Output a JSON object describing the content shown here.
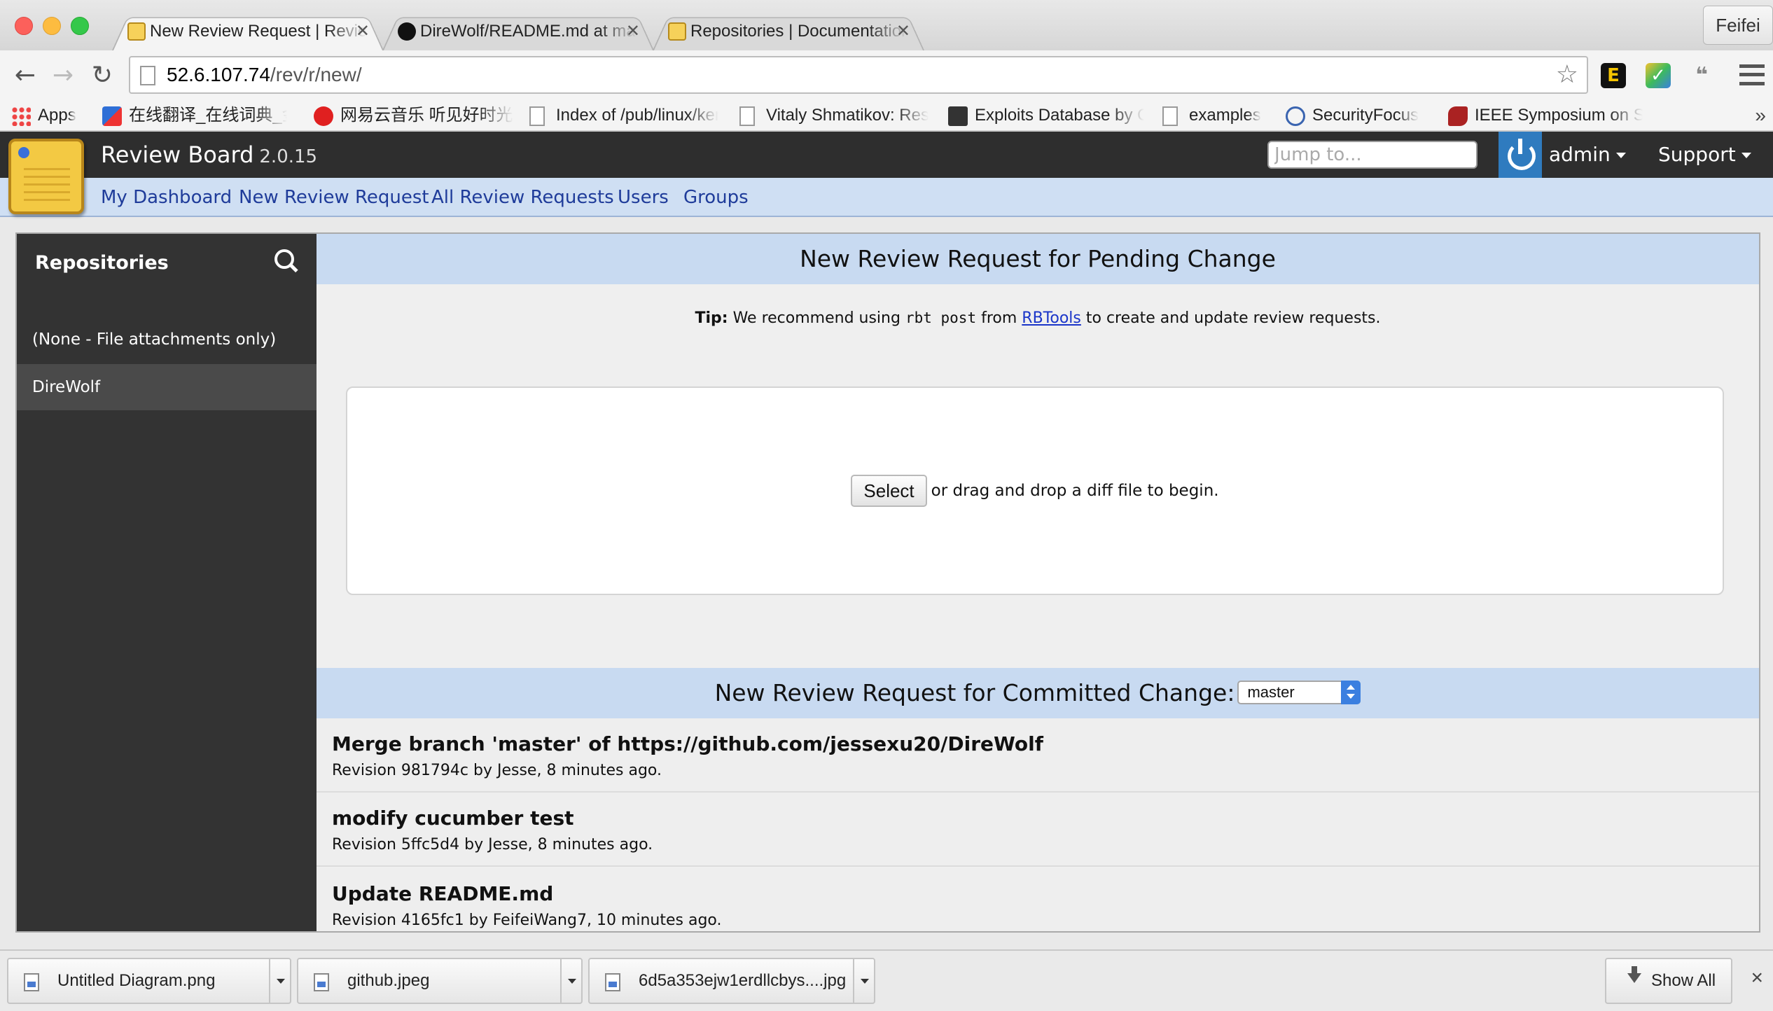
{
  "browser": {
    "tabs": [
      {
        "title": "New Review Request | Review Board",
        "active": true
      },
      {
        "title": "DireWolf/README.md at master",
        "active": false
      },
      {
        "title": "Repositories | Documentation",
        "active": false
      }
    ],
    "profile": "Feifei",
    "url_host": "52.6.107.74",
    "url_path": "/rev/r/new/",
    "bookmarks": [
      {
        "label": "Apps",
        "icon": "apps-grid-icon"
      },
      {
        "label": "在线翻译_在线词典_金山词霸",
        "icon": "dictionary-icon"
      },
      {
        "label": "网易云音乐 听见好时光",
        "icon": "netease-music-icon"
      },
      {
        "label": "Index of /pub/linux/kernel",
        "icon": "page-icon"
      },
      {
        "label": "Vitaly Shmatikov: Research",
        "icon": "page-icon"
      },
      {
        "label": "Exploits Database by Offensive",
        "icon": "exploit-db-icon"
      },
      {
        "label": "examples",
        "icon": "page-icon"
      },
      {
        "label": "SecurityFocus",
        "icon": "securityfocus-icon"
      },
      {
        "label": "IEEE Symposium on Security",
        "icon": "ieee-icon"
      }
    ],
    "bookmarks_overflow": "»"
  },
  "rb": {
    "product": "Review Board",
    "version": "2.0.15",
    "jump_placeholder": "Jump to...",
    "user": "admin",
    "support": "Support",
    "nav": [
      "My Dashboard",
      "New Review Request",
      "All Review Requests",
      "Users",
      "Groups"
    ]
  },
  "sidebar": {
    "title": "Repositories",
    "items": [
      {
        "label": "(None - File attachments only)",
        "selected": false
      },
      {
        "label": "DireWolf",
        "selected": true
      }
    ]
  },
  "pending": {
    "title": "New Review Request for Pending Change",
    "tip_label": "Tip:",
    "tip_before": " We recommend using ",
    "tip_code": "rbt post",
    "tip_from": " from ",
    "tip_link": "RBTools",
    "tip_after": " to create and update review requests.",
    "select_label": "Select",
    "drop_text": "or drag and drop a diff file to begin."
  },
  "committed": {
    "title": "New Review Request for Committed Change:",
    "branch": "master",
    "commits": [
      {
        "summary": "Merge branch 'master' of https://github.com/jessexu20/DireWolf",
        "meta": "Revision 981794c by Jesse, 8 minutes ago."
      },
      {
        "summary": "modify cucumber test",
        "meta": "Revision 5ffc5d4 by Jesse, 8 minutes ago."
      },
      {
        "summary": "Update README.md",
        "meta": "Revision 4165fc1 by FeifeiWang7, 10 minutes ago."
      }
    ]
  },
  "downloads": {
    "items": [
      "Untitled Diagram.png",
      "github.jpeg",
      "6d5a353ejw1erdllcbys....jpg"
    ],
    "show_all": "Show All",
    "close": "×"
  }
}
